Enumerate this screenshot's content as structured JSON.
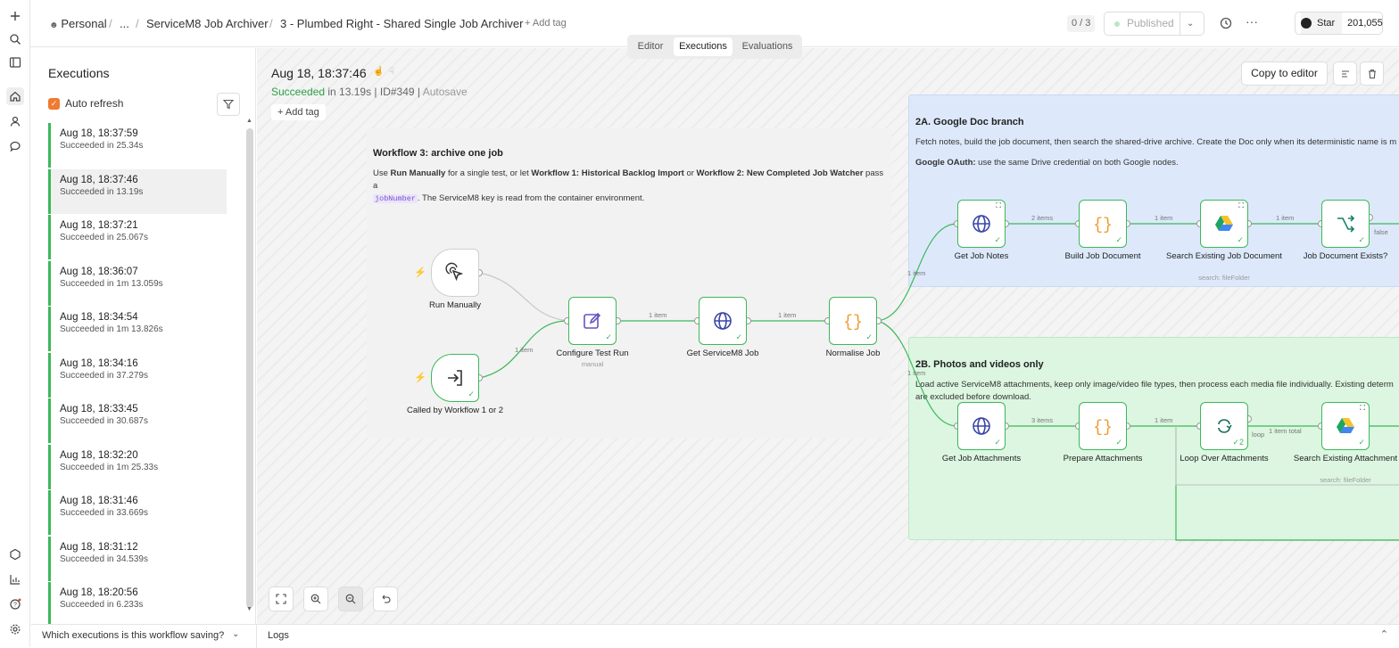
{
  "breadcrumb": {
    "items": [
      "Personal",
      "/",
      "...",
      "/",
      "ServiceM8 Job Archiver",
      "/",
      "3 - Plumbed Right - Shared Single Job Archiver"
    ],
    "add_tag": "+ Add tag"
  },
  "header": {
    "counter": "0 / 3",
    "publish_label": "Published",
    "star_label": "Star",
    "star_count": "201,055"
  },
  "tabs": [
    "Editor",
    "Executions",
    "Evaluations"
  ],
  "sidebar": {
    "title": "Executions",
    "auto_refresh_label": "Auto refresh",
    "auto_refresh_checked": true,
    "executions": [
      {
        "time": "Aug 18, 18:37:59",
        "status": "Succeeded in 25.34s"
      },
      {
        "time": "Aug 18, 18:37:46",
        "status": "Succeeded in 13.19s"
      },
      {
        "time": "Aug 18, 18:37:21",
        "status": "Succeeded in 25.067s"
      },
      {
        "time": "Aug 18, 18:36:07",
        "status": "Succeeded in 1m 13.059s"
      },
      {
        "time": "Aug 18, 18:34:54",
        "status": "Succeeded in 1m 13.826s"
      },
      {
        "time": "Aug 18, 18:34:16",
        "status": "Succeeded in 37.279s"
      },
      {
        "time": "Aug 18, 18:33:45",
        "status": "Succeeded in 30.687s"
      },
      {
        "time": "Aug 18, 18:32:20",
        "status": "Succeeded in 1m 25.33s"
      },
      {
        "time": "Aug 18, 18:31:46",
        "status": "Succeeded in 33.669s"
      },
      {
        "time": "Aug 18, 18:31:12",
        "status": "Succeeded in 34.539s"
      },
      {
        "time": "Aug 18, 18:20:56",
        "status": "Succeeded in 6.233s"
      }
    ],
    "selected_index": 1
  },
  "execution": {
    "title": "Aug 18, 18:37:46",
    "status_ok": "Succeeded",
    "status_rest": " in 13.19s | ID#349 | ",
    "autosave": "Autosave",
    "add_tag": "+ Add tag",
    "copy_label": "Copy to editor"
  },
  "sticky_main": {
    "title": "Workflow 3: archive one job",
    "p1": "Use ",
    "b1": "Run Manually",
    "p2": " for a single test, or let ",
    "b2": "Workflow 1: Historical Backlog Import",
    "p3": " or ",
    "b3": "Workflow 2: New Completed Job Watcher",
    "p4": " pass a ",
    "code": "jobNumber",
    "p5": ". The ServiceM8 key is read from the container environment."
  },
  "sticky_2a": {
    "title": "2A. Google Doc branch",
    "desc": "Fetch notes, build the job document, then search the shared-drive archive. Create the Doc only when its deterministic name is m",
    "oauth_bold": "Google OAuth:",
    "oauth_rest": " use the same Drive credential on both Google nodes."
  },
  "sticky_2b": {
    "title": "2B. Photos and videos only",
    "desc": "Load active ServiceM8 attachments, keep only image/video file types, then process each media file individually. Existing determ",
    "desc2": "are excluded before download."
  },
  "nodes": {
    "run_manually": "Run Manually",
    "called_by": "Called by Workflow 1 or 2",
    "configure": "Configure Test Run",
    "configure_sub": "manual",
    "get_job": "Get ServiceM8 Job",
    "normalise": "Normalise Job",
    "get_notes": "Get Job Notes",
    "build_doc": "Build Job Document",
    "search_doc": "Search Existing Job Document",
    "search_doc_sub": "search: fileFolder",
    "doc_exists": "Job Document Exists?",
    "get_attach": "Get Job Attachments",
    "prep_attach": "Prepare Attachments",
    "loop_attach": "Loop Over Attachments",
    "loop_count": "2",
    "search_attach": "Search Existing Attachment",
    "search_attach_sub": "search: fileFolder"
  },
  "edges": {
    "one_item": "1 item",
    "two_items": "2 items",
    "three_items": "3 items",
    "false_label": "false",
    "loop_label": "loop",
    "one_item_total": "1 item total"
  },
  "bottom": {
    "question": "Which executions is this workflow saving?",
    "logs": "Logs"
  },
  "colors": {
    "success": "#3cb859",
    "accent": "#ef7a30",
    "sticky_blue": "#dde9fb",
    "sticky_green": "#dcf6e1"
  },
  "icons": [
    "plus-icon",
    "search-icon",
    "sidebar-toggle-icon",
    "home-icon",
    "user-icon",
    "chat-icon",
    "templates-icon",
    "insights-icon",
    "help-icon",
    "settings-icon"
  ]
}
